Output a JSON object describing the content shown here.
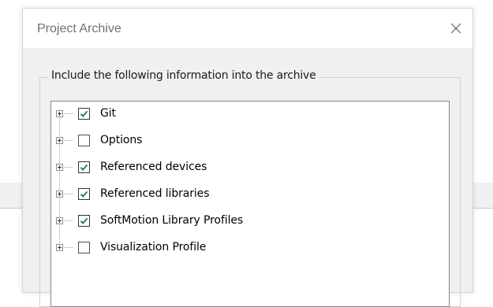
{
  "dialog": {
    "title": "Project Archive",
    "close_icon": "close-icon"
  },
  "group": {
    "legend": "Include the following information into the archive"
  },
  "tree": {
    "items": [
      {
        "label": "Git",
        "checked": true
      },
      {
        "label": "Options",
        "checked": false
      },
      {
        "label": "Referenced devices",
        "checked": true
      },
      {
        "label": "Referenced libraries",
        "checked": true
      },
      {
        "label": "SoftMotion Library Profiles",
        "checked": true
      },
      {
        "label": "Visualization Profile",
        "checked": false
      }
    ]
  },
  "colors": {
    "check_mark": "#1f7a3a",
    "dialog_bg": "#f0f0f0",
    "title_text": "#707070"
  }
}
